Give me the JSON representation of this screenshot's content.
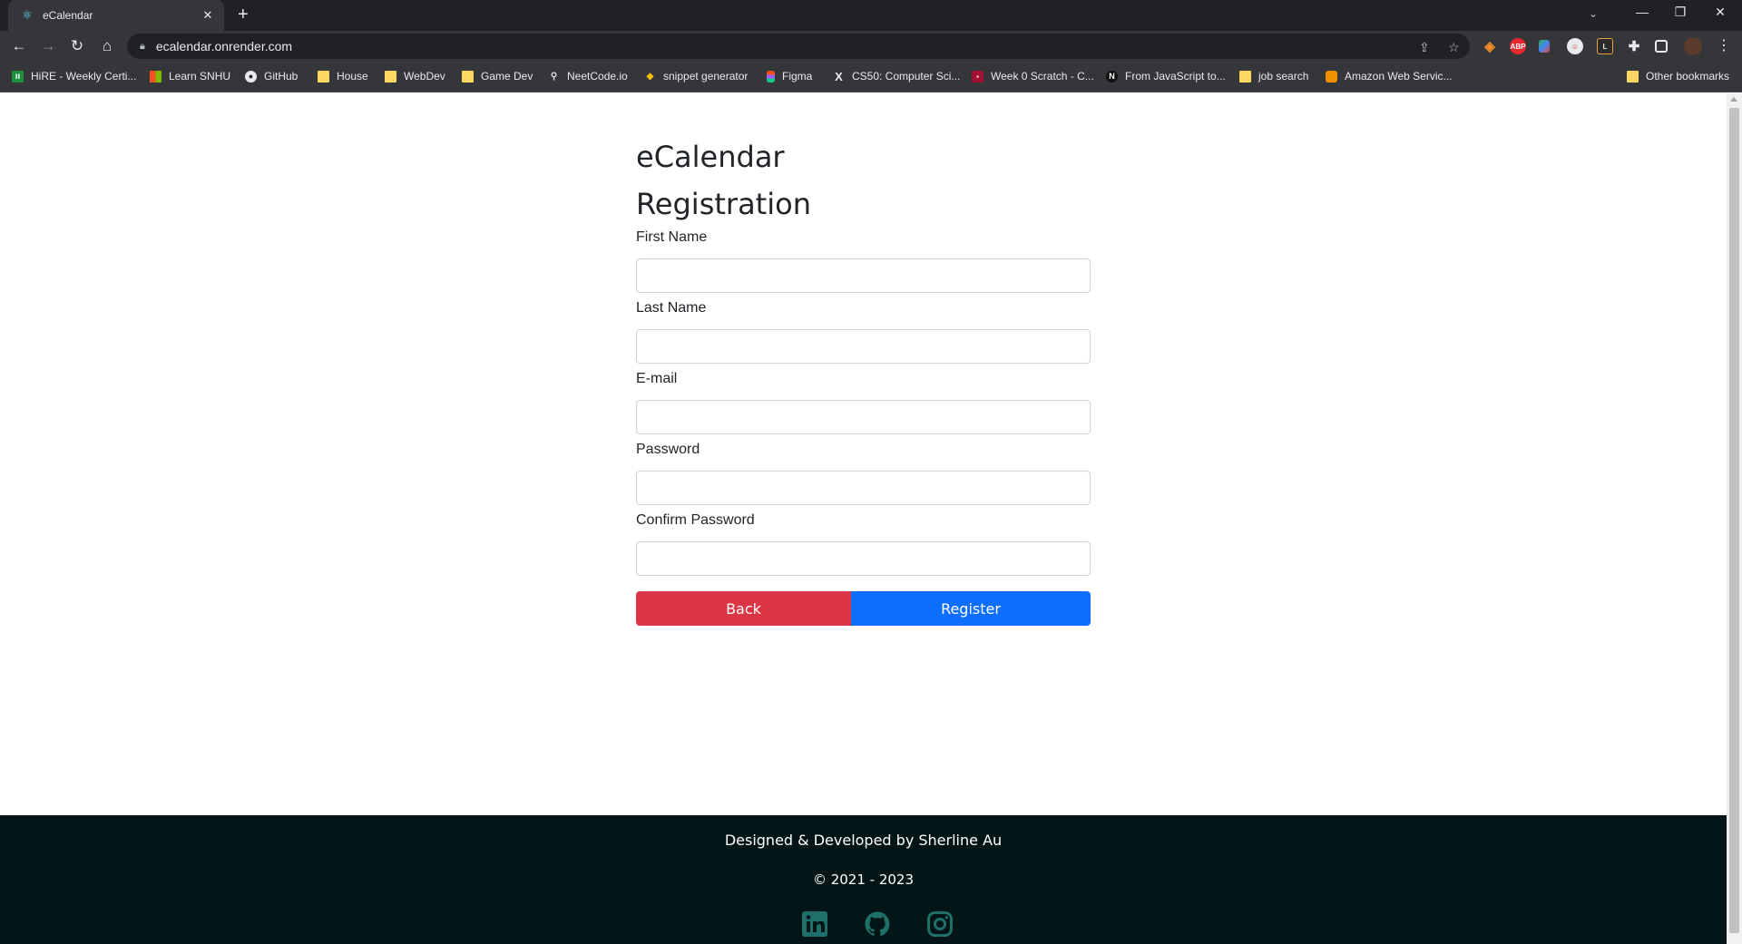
{
  "browser": {
    "tab_title": "eCalendar",
    "url": "ecalendar.onrender.com",
    "bookmarks": [
      {
        "label": "HiRE - Weekly Certi...",
        "icon": "hire-icon"
      },
      {
        "label": "Learn SNHU",
        "icon": "windows-icon"
      },
      {
        "label": "GitHub",
        "icon": "github-icon"
      },
      {
        "label": "House",
        "icon": "folder-icon"
      },
      {
        "label": "WebDev",
        "icon": "folder-icon"
      },
      {
        "label": "Game Dev",
        "icon": "folder-icon"
      },
      {
        "label": "NeetCode.io",
        "icon": "neetcode-icon"
      },
      {
        "label": "snippet generator",
        "icon": "snippet-icon"
      },
      {
        "label": "Figma",
        "icon": "figma-icon"
      },
      {
        "label": "CS50: Computer Sci...",
        "icon": "cs50-icon"
      },
      {
        "label": "Week 0 Scratch - C...",
        "icon": "harvard-icon"
      },
      {
        "label": "From JavaScript to...",
        "icon": "notion-icon"
      },
      {
        "label": "job search",
        "icon": "folder-icon"
      },
      {
        "label": "Amazon Web Servic...",
        "icon": "aws-icon"
      }
    ],
    "other_bookmarks": "Other bookmarks",
    "extensions": {
      "abp": "ABP",
      "l": "L"
    }
  },
  "page": {
    "app_title": "eCalendar",
    "heading": "Registration",
    "fields": [
      {
        "label": "First Name",
        "value": ""
      },
      {
        "label": "Last Name",
        "value": ""
      },
      {
        "label": "E-mail",
        "value": ""
      },
      {
        "label": "Password",
        "value": ""
      },
      {
        "label": "Confirm Password",
        "value": ""
      }
    ],
    "back_label": "Back",
    "register_label": "Register"
  },
  "footer": {
    "credit": "Designed & Developed by Sherline Au",
    "copyright": "© 2021 - 2023",
    "social_icons": [
      "linkedin-icon",
      "github-icon",
      "instagram-icon"
    ]
  },
  "colors": {
    "back_button": "#dc3545",
    "register_button": "#0d6efd",
    "footer_bg": "#031516",
    "social_icon": "#1f6f6a"
  }
}
